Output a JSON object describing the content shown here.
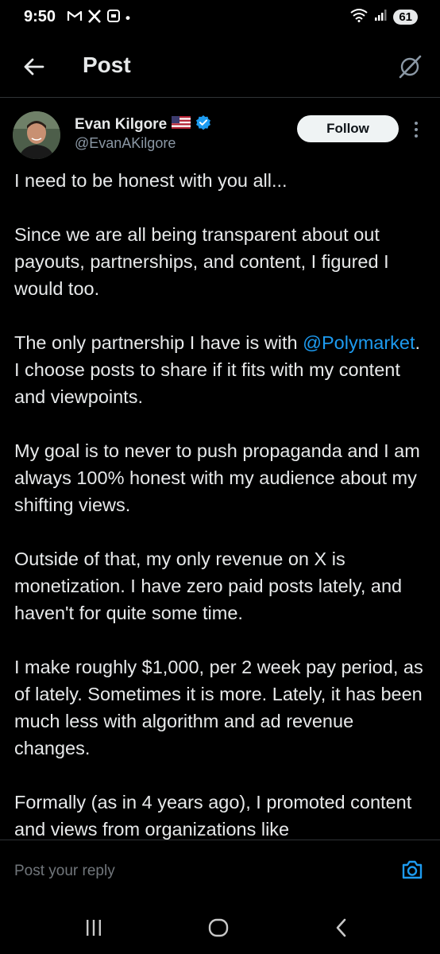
{
  "status_bar": {
    "time": "9:50",
    "notification_icons": [
      "gmail-icon",
      "x-icon",
      "screenshot-icon"
    ],
    "dot": "•",
    "battery": "61"
  },
  "header": {
    "title": "Post"
  },
  "author": {
    "name": "Evan Kilgore",
    "flag": "🇺🇸",
    "handle": "@EvanAKilgore",
    "verified": true,
    "follow_label": "Follow"
  },
  "post": {
    "p1": "I need to be honest with you all...",
    "p2": "Since we are all being transparent about out payouts, partnerships, and content, I figured I would too.",
    "p3_before": "The only partnership I have is with ",
    "p3_mention": "@Polymarket",
    "p3_after": ". I choose posts to share if it fits with my content and viewpoints.",
    "p4": "My goal is to never to push propaganda and I am always 100% honest with my audience about my shifting views.",
    "p5": "Outside of that, my only revenue on X is monetization. I have zero paid posts lately, and haven't for quite some time.",
    "p6": "I make roughly $1,000, per 2 week pay period, as of lately. Sometimes it is more. Lately, it has been much less with algorithm and ad revenue changes.",
    "p7": "Formally (as in 4 years ago), I promoted content and views from organizations like"
  },
  "reply": {
    "placeholder": "Post your reply"
  },
  "colors": {
    "background": "#000000",
    "text": "#e7e9ea",
    "secondary": "#8b98a5",
    "accent": "#1d9bf0",
    "divider": "#2f3336"
  }
}
